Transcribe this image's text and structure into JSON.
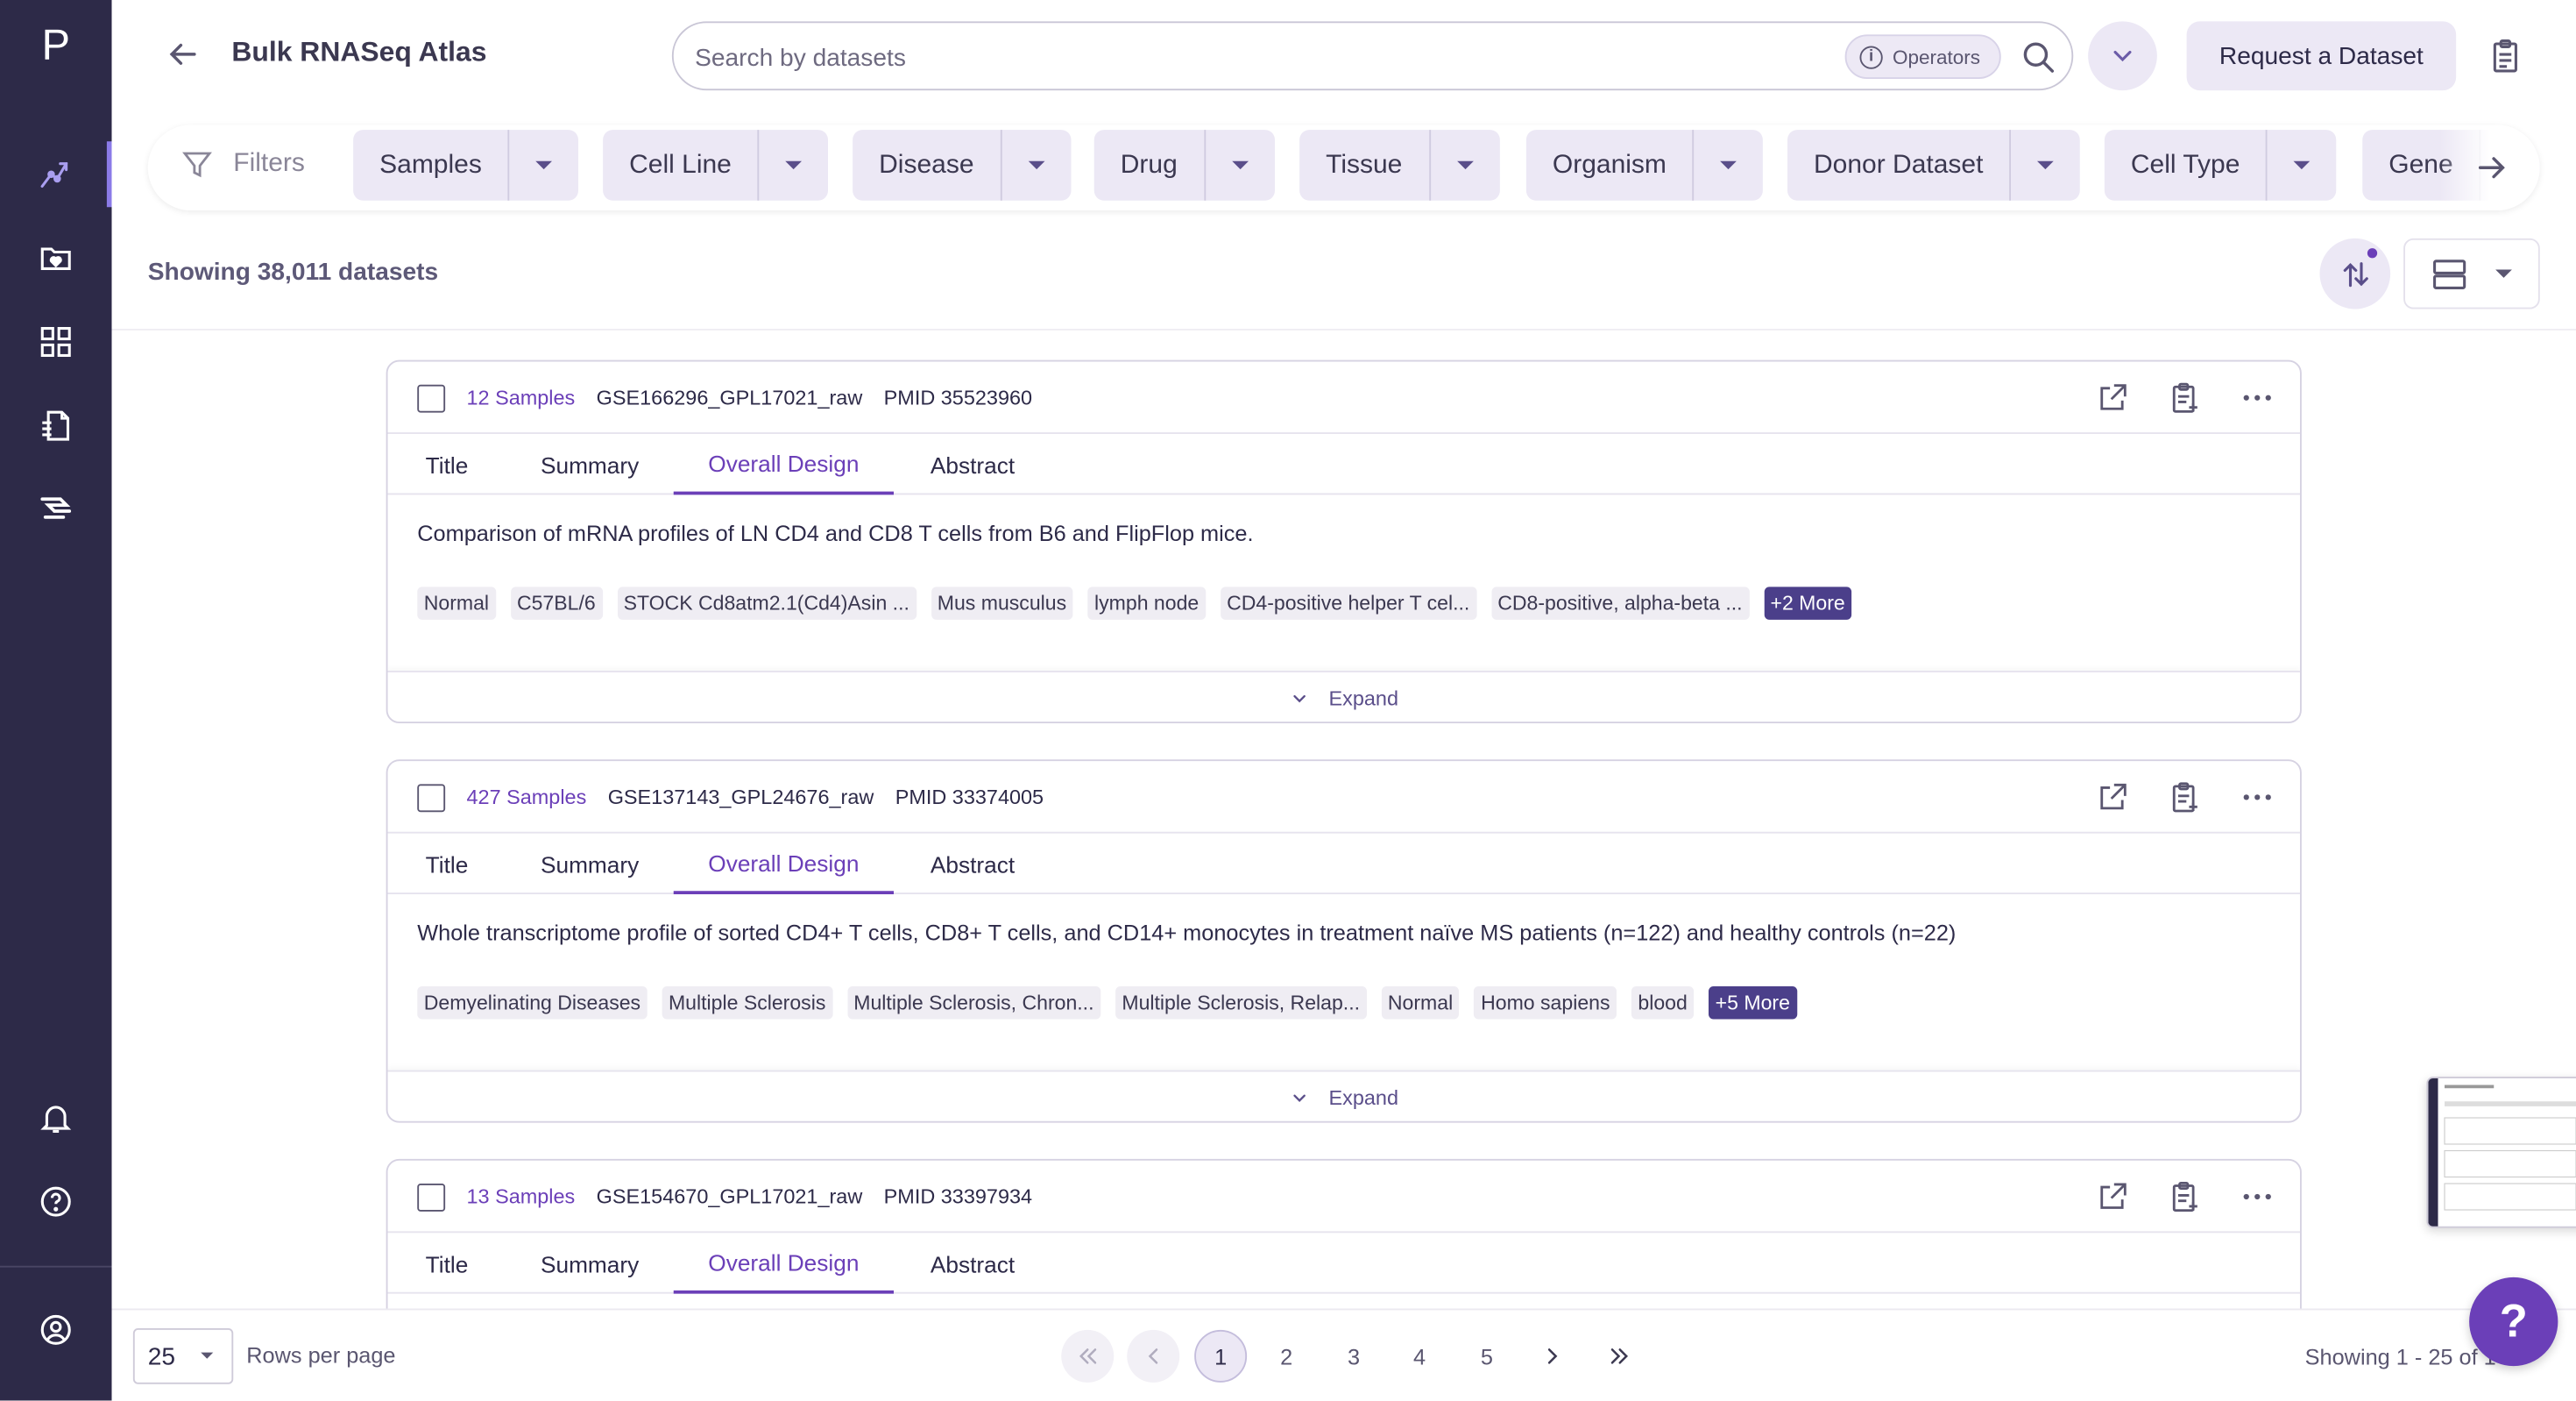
{
  "app": {
    "logo": "P",
    "title": "Bulk RNASeq Atlas"
  },
  "search": {
    "placeholder": "Search by datasets",
    "operators_label": "Operators"
  },
  "header": {
    "request_label": "Request a Dataset"
  },
  "sidebar": {
    "items": [
      "explorer-icon",
      "saved-datasets-icon",
      "apps-grid-icon",
      "reports-icon",
      "pipelines-icon"
    ],
    "bottom": [
      "bell-icon",
      "help-icon",
      "account-icon"
    ]
  },
  "filters": {
    "label": "Filters",
    "chips": [
      "Samples",
      "Cell Line",
      "Disease",
      "Drug",
      "Tissue",
      "Organism",
      "Donor Dataset",
      "Cell Type",
      "Gene"
    ]
  },
  "results": {
    "showing": "Showing 38,011 datasets"
  },
  "tabs": {
    "title": "Title",
    "summary": "Summary",
    "overall_design": "Overall Design",
    "abstract": "Abstract"
  },
  "expand_label": "Expand",
  "datasets": [
    {
      "samples": "12 Samples",
      "id": "GSE166296_GPL17021_raw",
      "pmid": "PMID 35523960",
      "description": "Comparison of mRNA profiles of LN CD4 and CD8 T cells from B6 and FlipFlop mice.",
      "tags": [
        "Normal",
        "C57BL/6",
        "STOCK Cd8atm2.1(Cd4)Asin ...",
        "Mus musculus",
        "lymph node",
        "CD4-positive helper T cel...",
        "CD8-positive, alpha-beta ..."
      ],
      "more": "+2 More"
    },
    {
      "samples": "427 Samples",
      "id": "GSE137143_GPL24676_raw",
      "pmid": "PMID 33374005",
      "description": "Whole transcriptome profile of sorted CD4+ T cells, CD8+ T cells, and CD14+ monocytes in treatment naïve MS patients (n=122) and healthy controls (n=22)",
      "tags": [
        "Demyelinating Diseases",
        "Multiple Sclerosis",
        "Multiple Sclerosis, Chron...",
        "Multiple Sclerosis, Relap...",
        "Normal",
        "Homo sapiens",
        "blood"
      ],
      "more": "+5 More"
    },
    {
      "samples": "13 Samples",
      "id": "GSE154670_GPL17021_raw",
      "pmid": "PMID 33397934"
    }
  ],
  "pagination": {
    "rows_value": "25",
    "rows_label": "Rows per page",
    "pages": [
      "1",
      "2",
      "3",
      "4",
      "5"
    ],
    "current": "1",
    "info": "Showing 1 - 25 of 1"
  },
  "help_label": "?",
  "colors": {
    "sidebar": "#2d2a48",
    "accent": "#6b3fb8",
    "chip": "#ece8f5",
    "tag_more": "#4b3f8a"
  }
}
